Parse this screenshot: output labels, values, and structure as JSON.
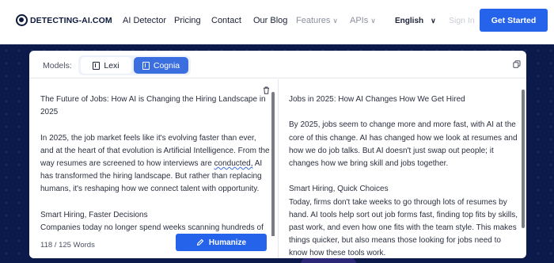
{
  "header": {
    "logo": "DETECTING-AI.COM",
    "nav": [
      {
        "label": "AI Detector"
      },
      {
        "label": "Pricing"
      },
      {
        "label": "Contact"
      },
      {
        "label": "Our Blog"
      },
      {
        "label": "Features"
      },
      {
        "label": "APIs"
      }
    ],
    "language": "English",
    "sign_in": "Sign In",
    "get_started": "Get Started"
  },
  "models": {
    "label": "Models:",
    "options": [
      "Lexi",
      "Cognia"
    ],
    "selected": "Cognia"
  },
  "input": {
    "title": "The Future of Jobs: How AI is Changing the Hiring Landscape in 2025",
    "para1_a": "In 2025, the job market feels like it's evolving faster than ever, and at the heart of that evolution is Artificial Intelligence. From the way resumes are screened to how interviews are ",
    "para1_flag": "conducted,",
    "para1_b": " AI has transformed the hiring landscape. But rather than replacing humans, it's reshaping how we connect talent with opportunity.",
    "heading2": "Smart Hiring, Faster Decisions",
    "para2": "Companies today no longer spend weeks scanning hundreds of resumes. Instead, AI-powered tools sort through thousands of applications in minutes."
  },
  "output": {
    "title": "Jobs in 2025: How AI Changes How We Get Hired",
    "para1": "By 2025, jobs seem to change more and more fast, with AI at the core of this change. AI has changed how we look at resumes and how we do job talks. But AI doesn't just swap out people; it changes how we bring skill and jobs together.",
    "heading2": "Smart Hiring, Quick Choices",
    "para2": "Today, firms don't take weeks to go through lots of resumes by hand. AI tools help sort out job forms fast, finding top fits by skills, past work, and even how one fits with the team style. This makes things quicker, but also means those looking for jobs need to know how these tools work."
  },
  "footer": {
    "word_count": "118 / 125 Words",
    "humanize": "Humanize"
  },
  "colors": {
    "brand": "#2563eb",
    "page_background": "#0b1a4a",
    "selected_model": "#3b6fe0"
  }
}
